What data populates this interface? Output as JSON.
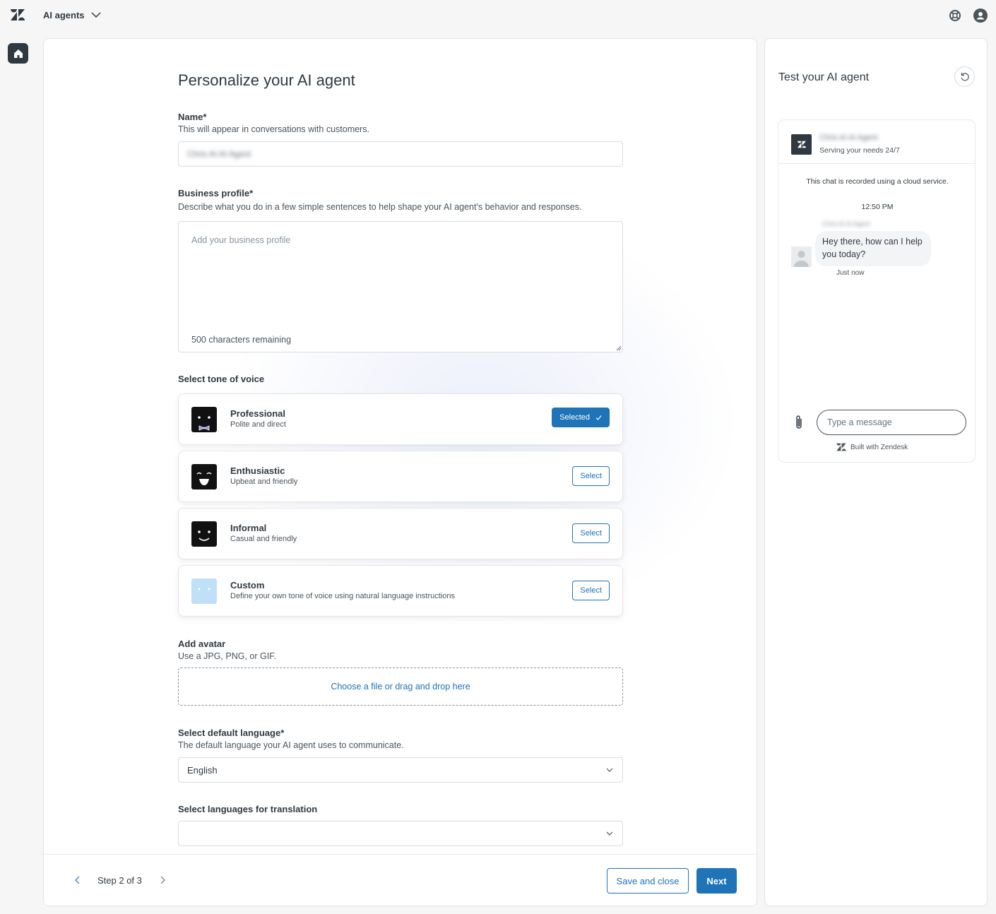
{
  "topbar": {
    "product_switcher_label": "AI agents"
  },
  "form": {
    "title": "Personalize your AI agent",
    "name": {
      "label": "Name*",
      "hint": "This will appear in conversations with customers.",
      "value": "Chris AI AI Agent"
    },
    "business_profile": {
      "label": "Business profile*",
      "hint": "Describe what you do in a few simple sentences to help shape your AI agent's behavior and responses.",
      "placeholder": "Add your business profile",
      "counter": "500 characters remaining"
    },
    "tone": {
      "label": "Select tone of voice",
      "options": [
        {
          "name": "Professional",
          "desc": "Polite and direct",
          "button": "Selected",
          "selected": true
        },
        {
          "name": "Enthusiastic",
          "desc": "Upbeat and friendly",
          "button": "Select",
          "selected": false
        },
        {
          "name": "Informal",
          "desc": "Casual and friendly",
          "button": "Select",
          "selected": false
        },
        {
          "name": "Custom",
          "desc": "Define your own tone of voice using natural language instructions",
          "button": "Select",
          "selected": false
        }
      ]
    },
    "avatar": {
      "label": "Add avatar",
      "hint": "Use a JPG, PNG, or GIF.",
      "dropzone": "Choose a file or drag and drop here"
    },
    "default_language": {
      "label": "Select default language*",
      "hint": "The default language your AI agent uses to communicate.",
      "value": "English"
    },
    "translation_languages": {
      "label": "Select languages for translation",
      "value": ""
    }
  },
  "footer": {
    "step": "Step 2 of 3",
    "save_close": "Save and close",
    "next": "Next"
  },
  "test_panel": {
    "title": "Test your AI agent",
    "agent_name": "Chris AI AI Agent",
    "agent_subtitle": "Serving your needs 24/7",
    "notice": "This chat is recorded using a cloud service.",
    "timestamp": "12:50 PM",
    "sender": "Chris AI AI Agent",
    "message": "Hey there, how can I help you today?",
    "message_status": "Just now",
    "input_placeholder": "Type a message",
    "built_with": "Built with Zendesk"
  },
  "colors": {
    "accent": "#1f73b7",
    "text": "#2f3941",
    "custom_avatar": "#bfe0f7"
  }
}
